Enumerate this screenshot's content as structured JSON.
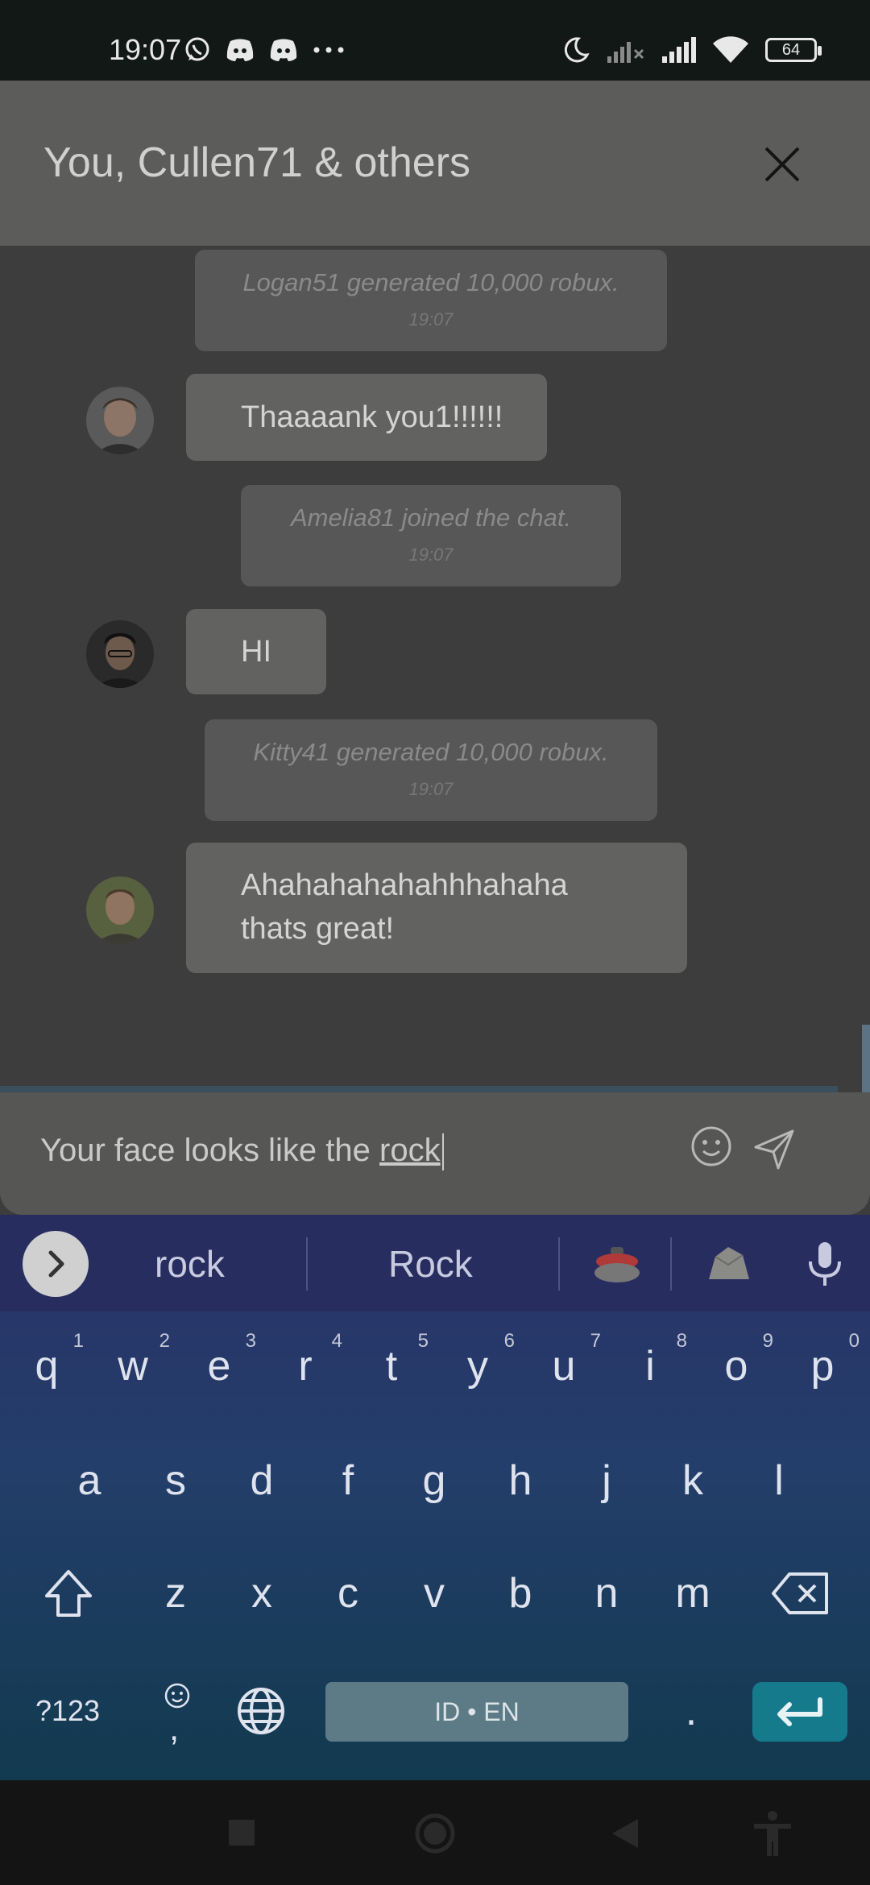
{
  "status_bar": {
    "time": "19:07",
    "left_icons": [
      "whatsapp-icon",
      "discord-icon",
      "discord-icon",
      "more-notifications-icon"
    ],
    "right_icons": [
      "do-not-disturb-moon-icon",
      "signal-no-service-icon",
      "signal-icon",
      "wifi-icon"
    ],
    "battery": "64"
  },
  "header": {
    "title": "You, Cullen71 & others",
    "close_icon": "close-icon"
  },
  "messages": {
    "sys1": {
      "text": "Logan51 generated 10,000 robux.",
      "time": "19:07"
    },
    "msg1": {
      "text": "Thaaaank you1!!!!!!"
    },
    "sys2": {
      "text": "Amelia81 joined the chat.",
      "time": "19:07"
    },
    "msg2": {
      "text": "HI"
    },
    "sys3": {
      "text": "Kitty41 generated 10,000 robux.",
      "time": "19:07"
    },
    "msg3": {
      "line1": "Ahahahahahahhhahaha",
      "line2": "thats great!"
    }
  },
  "composer": {
    "text_before": "Your face looks like the ",
    "text_underlined": "rock",
    "emoji_icon": "smiley-icon",
    "send_icon": "send-icon"
  },
  "keyboard": {
    "suggestions": [
      "rock",
      "Rock"
    ],
    "emoji_suggestions": [
      "curling-stone-emoji",
      "rock-emoji"
    ],
    "row1": [
      {
        "k": "q",
        "h": "1"
      },
      {
        "k": "w",
        "h": "2"
      },
      {
        "k": "e",
        "h": "3"
      },
      {
        "k": "r",
        "h": "4"
      },
      {
        "k": "t",
        "h": "5"
      },
      {
        "k": "y",
        "h": "6"
      },
      {
        "k": "u",
        "h": "7"
      },
      {
        "k": "i",
        "h": "8"
      },
      {
        "k": "o",
        "h": "9"
      },
      {
        "k": "p",
        "h": "0"
      }
    ],
    "row2": [
      "a",
      "s",
      "d",
      "f",
      "g",
      "h",
      "j",
      "k",
      "l"
    ],
    "row3": [
      "z",
      "x",
      "c",
      "v",
      "b",
      "n",
      "m"
    ],
    "symbols_label": "?123",
    "comma_label": ",",
    "space_label": "ID • EN",
    "period_label": "."
  },
  "colors": {
    "accent_enter": "#157a8c",
    "keyboard_top": "#2a3268",
    "keyboard_bottom": "#123a4f"
  }
}
